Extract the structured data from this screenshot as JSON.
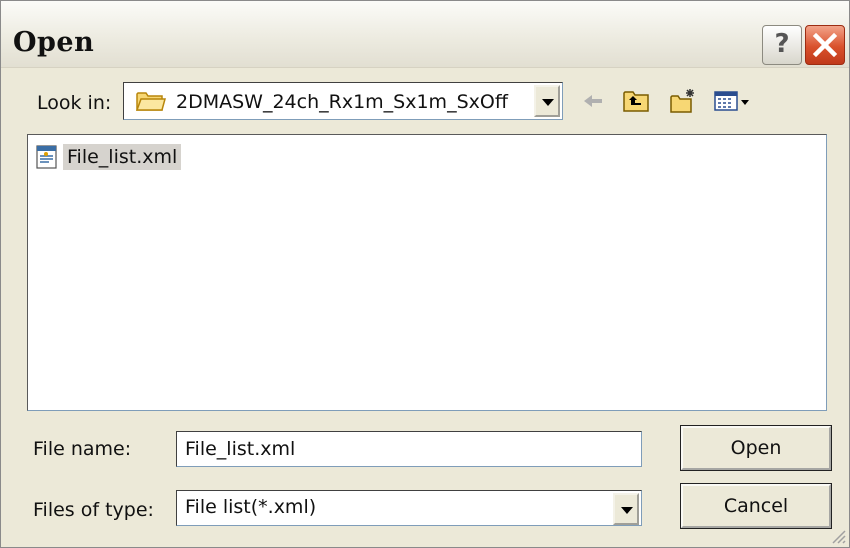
{
  "window": {
    "title": "Open",
    "help_label": "?"
  },
  "lookin": {
    "label": "Look in:",
    "value": "2DMASW_24ch_Rx1m_Sx1m_SxOff",
    "icon": "folder-icon"
  },
  "toolbar": {
    "items": [
      "back-arrow-icon",
      "up-folder-icon",
      "new-folder-icon",
      "view-menu-icon"
    ]
  },
  "files": [
    {
      "name": "File_list.xml",
      "icon": "xml-file-icon",
      "selected": true
    }
  ],
  "filename": {
    "label": "File name:",
    "value": "File_list.xml"
  },
  "filetype": {
    "label": "Files of type:",
    "value": "File list(*.xml)"
  },
  "buttons": {
    "open": "Open",
    "cancel": "Cancel"
  },
  "colors": {
    "dialog_bg": "#ece9d8",
    "close_red": "#d9512c",
    "selection": "#d6d3ce"
  }
}
